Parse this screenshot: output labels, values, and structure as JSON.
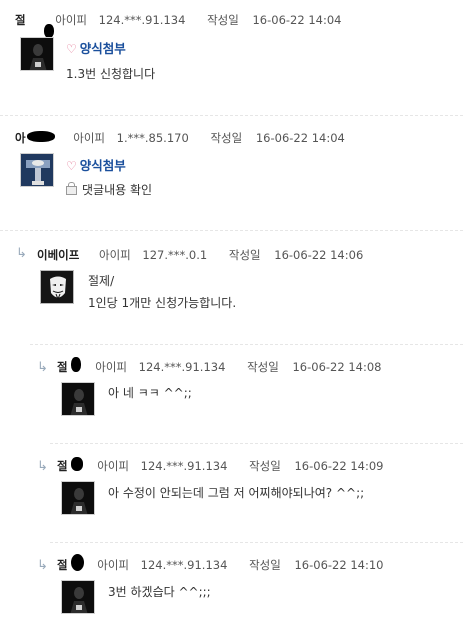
{
  "labels": {
    "ip": "아이피",
    "date": "작성일"
  },
  "comments": [
    {
      "name": "절",
      "ip": "124.***.91.134",
      "date": "16-06-22 14:04",
      "group": "양식첨부",
      "body": [
        "1.3번 신청합니다"
      ]
    },
    {
      "name": "아",
      "ip": "1.***.85.170",
      "date": "16-06-22 14:04",
      "group": "양식첨부",
      "body": [
        "댓글내용 확인"
      ]
    },
    {
      "name": "이베이프",
      "ip": "127.***.0.1",
      "date": "16-06-22 14:06",
      "body": [
        "절제/",
        "1인당 1개만 신청가능합니다."
      ]
    },
    {
      "name": "절",
      "ip": "124.***.91.134",
      "date": "16-06-22 14:08",
      "body": [
        "아 네 ㅋㅋ ^^;;"
      ]
    },
    {
      "name": "절",
      "ip": "124.***.91.134",
      "date": "16-06-22 14:09",
      "body": [
        "아 수정이 안되는데 그럼 저 어찌해야되나여? ^^;;"
      ]
    },
    {
      "name": "절",
      "ip": "124.***.91.134",
      "date": "16-06-22 14:10",
      "body": [
        "3번 하겠습다 ^^;;;"
      ]
    }
  ]
}
